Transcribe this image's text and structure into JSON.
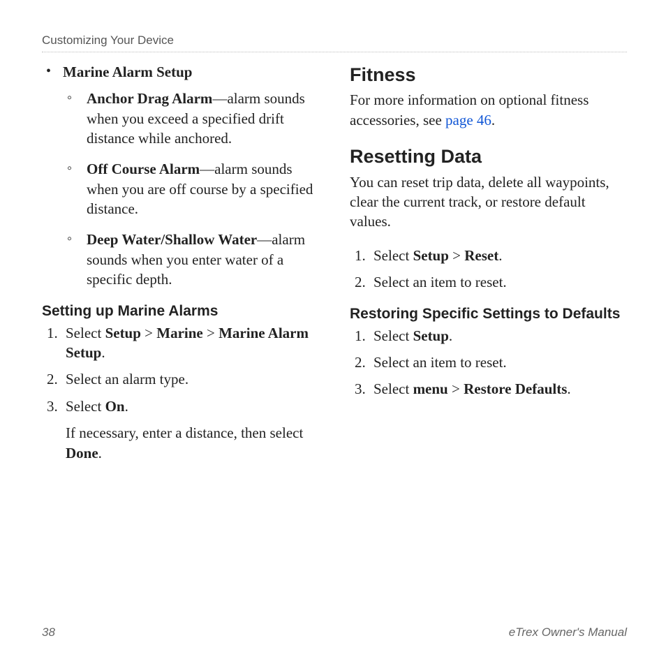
{
  "header": {
    "title": "Customizing Your Device"
  },
  "left": {
    "mainBullet": "Marine Alarm Setup",
    "sub": [
      {
        "term": "Anchor Drag Alarm",
        "dash": "—",
        "desc": "alarm sounds when you exceed a specified drift distance while anchored."
      },
      {
        "term": "Off Course Alarm",
        "dash": "—",
        "desc": "alarm sounds when you are off course by a specified distance."
      },
      {
        "term": "Deep Water/Shallow Water",
        "dash": "—",
        "desc": "alarm sounds when you enter water of a specific depth."
      }
    ],
    "settingHeading": "Setting up Marine Alarms",
    "steps": {
      "s1a": "Select ",
      "s1b": "Setup",
      "s1c": " > ",
      "s1d": "Marine",
      "s1e": " > ",
      "s1f": "Marine Alarm Setup",
      "s1g": ".",
      "s2": "Select an alarm type.",
      "s3a": "Select ",
      "s3b": "On",
      "s3c": ".",
      "s3extraA": "If necessary, enter a distance, then select ",
      "s3extraB": "Done",
      "s3extraC": "."
    }
  },
  "right": {
    "fitnessHeading": "Fitness",
    "fitnessTextA": "For more information on optional fitness accessories, see ",
    "fitnessLink": "page 46",
    "fitnessTextB": ".",
    "resetHeading": "Resetting Data",
    "resetBody": "You can reset trip data, delete all waypoints, clear the current track, or restore default values.",
    "resetSteps": {
      "s1a": "Select ",
      "s1b": "Setup",
      "s1c": " > ",
      "s1d": "Reset",
      "s1e": ".",
      "s2": "Select an item to reset."
    },
    "restoreHeading": "Restoring Specific Settings to Defaults",
    "restoreSteps": {
      "s1a": "Select ",
      "s1b": "Setup",
      "s1c": ".",
      "s2": "Select an item to reset.",
      "s3a": "Select ",
      "s3b": "menu",
      "s3c": " > ",
      "s3d": "Restore Defaults",
      "s3e": "."
    }
  },
  "footer": {
    "pageNum": "38",
    "manual": "eTrex Owner's Manual"
  }
}
